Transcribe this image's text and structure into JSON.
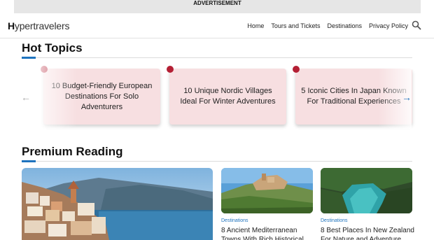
{
  "ad": {
    "label": "ADVERTISEMENT"
  },
  "header": {
    "logo_initial": "H",
    "logo_rest": "ypertravelers",
    "nav": [
      "Home",
      "Tours and Tickets",
      "Destinations",
      "Privacy Policy"
    ]
  },
  "hot_topics": {
    "title": "Hot Topics",
    "cards": [
      "10 Budget-Friendly European Destinations For Solo Adventurers",
      "10 Unique Nordic Villages Ideal For Winter Adventures",
      "5 Iconic Cities In Japan Known For Traditional Experiences"
    ],
    "prev_arrow": "←",
    "next_arrow": "→"
  },
  "premium": {
    "title": "Premium Reading",
    "articles": [
      {
        "category": "Destinations",
        "title": "8 Ancient Mediterranean Towns With Rich Historical"
      },
      {
        "category": "Destinations",
        "title": "8 Best Places In New Zealand For Nature and Adventure"
      }
    ]
  },
  "colors": {
    "accent": "#1e73be",
    "card_bg": "#f7dfe1",
    "dot": "#b41f34"
  },
  "icons": [
    "search-icon",
    "arrow-left-icon",
    "arrow-right-icon"
  ]
}
